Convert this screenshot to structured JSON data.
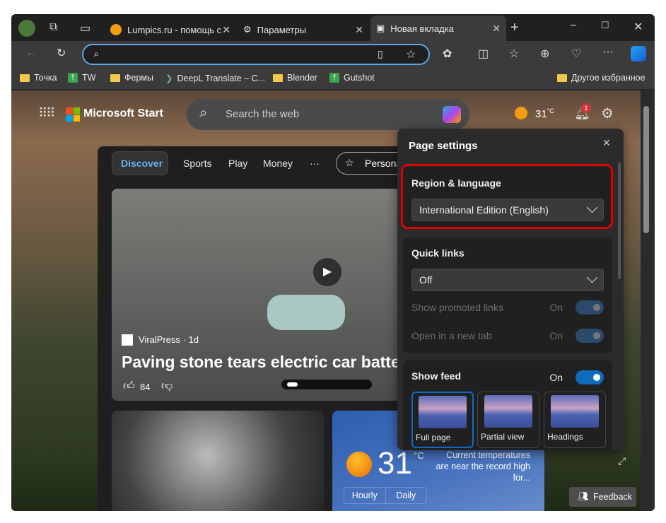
{
  "browser": {
    "tabs": [
      {
        "label": "Lumpics.ru - помощь с",
        "icon": "orange-icon"
      },
      {
        "label": "Параметры",
        "icon": "gear-icon"
      },
      {
        "label": "Новая вкладка",
        "icon": "newtab-icon",
        "active": true
      }
    ],
    "address": {
      "value": "",
      "placeholder": ""
    },
    "bookmarks": [
      {
        "label": "Точка",
        "icon": "folder-icon"
      },
      {
        "label": "TW",
        "icon": "tw-icon"
      },
      {
        "label": "Фермы",
        "icon": "folder-icon"
      },
      {
        "label": "DeepL Translate – C...",
        "icon": "deepl-icon"
      },
      {
        "label": "Blender",
        "icon": "folder-icon"
      },
      {
        "label": "Gutshot",
        "icon": "tw-icon"
      }
    ],
    "other_favorites": "Другое избранное"
  },
  "start": {
    "brand": "Microsoft Start",
    "search_placeholder": "Search the web",
    "weather_temp": "31",
    "weather_unit": "°C",
    "notifications": "1",
    "nav": [
      "Discover",
      "Sports",
      "Play",
      "Money",
      "···",
      "Personalize"
    ],
    "hero": {
      "source": "ViralPress · 1d",
      "title": "Paving stone tears electric car batte",
      "likes": "84"
    },
    "weather_card": {
      "temp": "31",
      "unit": "°C",
      "note": "Current temperatures are near the record high for...",
      "tabs": [
        "Hourly",
        "Daily"
      ]
    },
    "feedback": "Feedback"
  },
  "page_settings": {
    "title": "Page settings",
    "region": {
      "heading": "Region & language",
      "value": "International Edition (English)"
    },
    "quick_links": {
      "heading": "Quick links",
      "value": "Off",
      "rows": [
        {
          "label": "Show promoted links",
          "state": "On"
        },
        {
          "label": "Open in a new tab",
          "state": "On"
        }
      ]
    },
    "feed": {
      "heading": "Show feed",
      "state": "On",
      "layouts": [
        "Full page",
        "Partial view",
        "Headings"
      ]
    }
  },
  "colors": {
    "highlight": "#e00000",
    "accent": "#0f6cbd"
  }
}
